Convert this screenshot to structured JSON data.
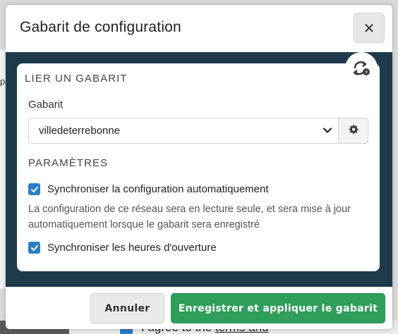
{
  "background": {
    "left_fragment": "pa",
    "bottom_text": "I agree to the",
    "bottom_link": "terms and"
  },
  "modal": {
    "title": "Gabarit de configuration",
    "close_label": "✕"
  },
  "template_section": {
    "heading": "LIER UN GABARIT",
    "field_label": "Gabarit",
    "selected_value": "villedeterrebonne"
  },
  "settings_section": {
    "heading": "PARAMÈTRES",
    "auto_sync_label": "Synchroniser la configuration automatiquement",
    "auto_sync_checked": true,
    "auto_sync_help": "La configuration de ce réseau sera en lecture seule, et sera mise à jour automatiquement lorsque le gabarit sera enregistré",
    "hours_sync_label": "Synchroniser les heures d'ouverture",
    "hours_sync_checked": true
  },
  "footer": {
    "cancel_label": "Annuler",
    "save_label": "Enregistrer et appliquer le gabarit"
  },
  "colors": {
    "body_bg": "#1f3a4a",
    "checkbox": "#2b7fc3",
    "primary": "#2f9e5b"
  },
  "icons": {
    "close": "close-icon",
    "sync": "sync-icon",
    "chevron": "chevron-down-icon",
    "gear": "gear-icon",
    "check": "check-icon"
  }
}
